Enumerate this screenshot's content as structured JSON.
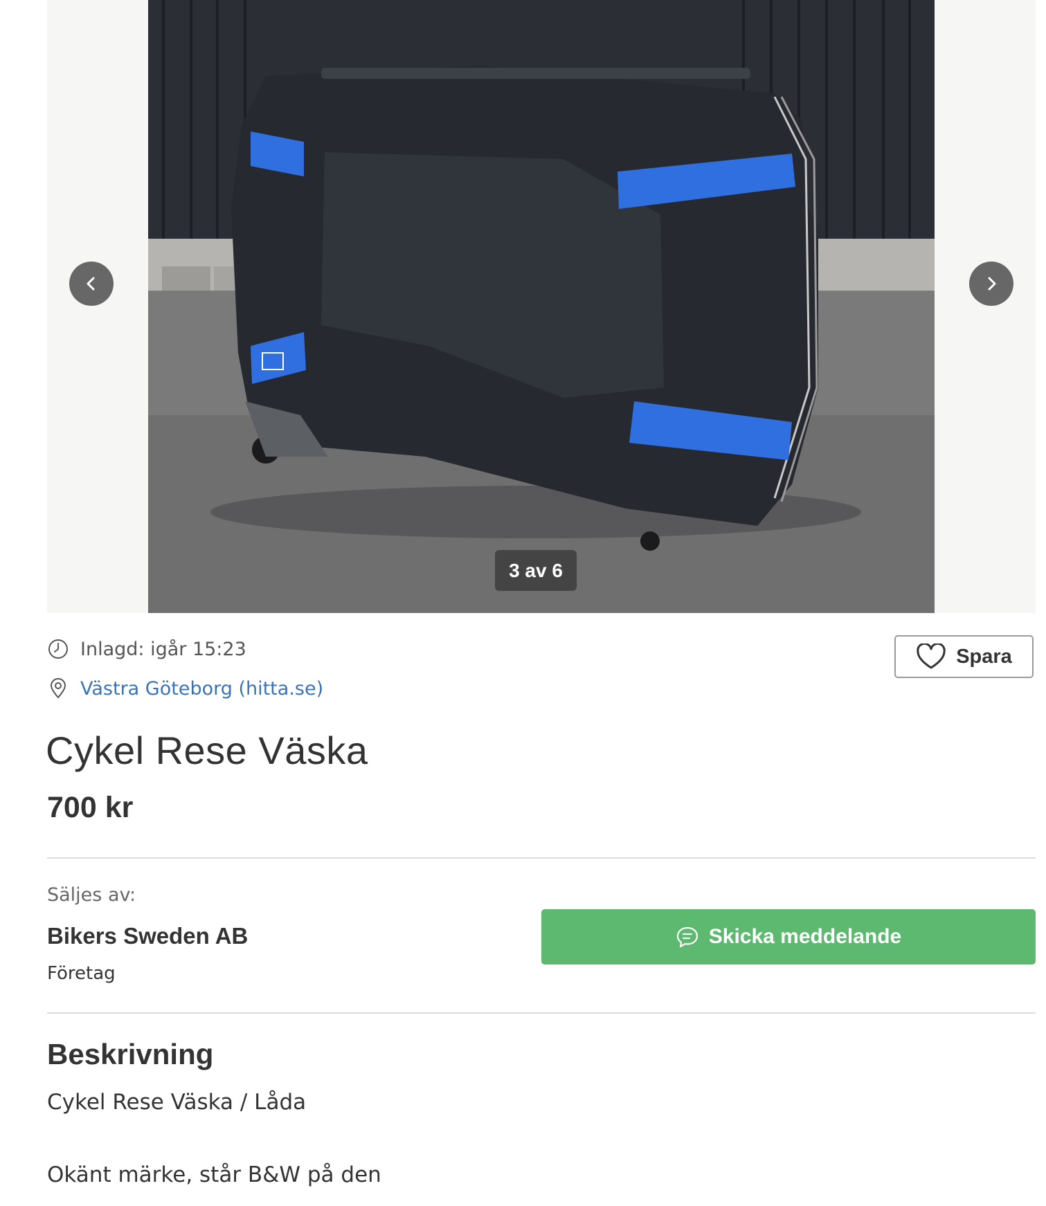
{
  "gallery": {
    "counter": "3 av 6",
    "image_alt": "Cykel Rese Väska"
  },
  "meta": {
    "posted": "Inlagd: igår 15:23",
    "location": "Västra Göteborg (hitta.se)"
  },
  "actions": {
    "save_label": "Spara",
    "message_label": "Skicka meddelande"
  },
  "listing": {
    "title": "Cykel Rese Väska",
    "price": "700 kr"
  },
  "seller": {
    "label": "Säljes av:",
    "name": "Bikers Sweden AB",
    "type": "Företag"
  },
  "description": {
    "heading": "Beskrivning",
    "lines": [
      "Cykel Rese Väska / Låda",
      "Okänt märke, står B&W på den"
    ]
  },
  "colors": {
    "link": "#3a73b5",
    "primary_button": "#5cb96f",
    "accent_strap": "#2f6fe0"
  },
  "icons": [
    "chevron-left-icon",
    "chevron-right-icon",
    "clock-icon",
    "location-pin-icon",
    "heart-icon",
    "chat-bubble-icon"
  ]
}
